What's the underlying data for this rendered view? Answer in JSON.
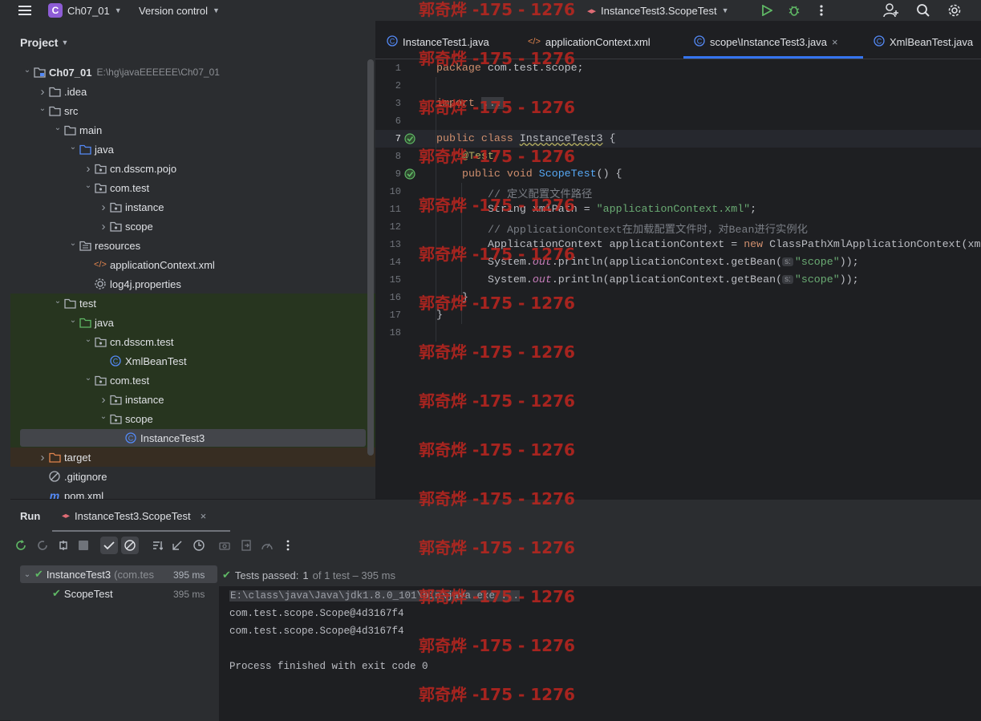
{
  "topbar": {
    "project_badge": "C",
    "project_name": "Ch07_01",
    "vcs_label": "Version control",
    "run_config": "InstanceTest3.ScopeTest"
  },
  "project_panel": {
    "title": "Project",
    "tree": [
      {
        "label": "Ch07_01",
        "path": "E:\\hg\\javaEEEEEE\\Ch07_01",
        "icon": "module-folder-icon"
      },
      {
        "label": ".idea",
        "icon": "folder-icon"
      },
      {
        "label": "src",
        "icon": "folder-icon"
      },
      {
        "label": "main",
        "icon": "folder-icon"
      },
      {
        "label": "java",
        "icon": "source-folder-icon"
      },
      {
        "label": "cn.dsscm.pojo",
        "icon": "package-icon"
      },
      {
        "label": "com.test",
        "icon": "package-icon"
      },
      {
        "label": "instance",
        "icon": "package-icon"
      },
      {
        "label": "scope",
        "icon": "package-icon"
      },
      {
        "label": "resources",
        "icon": "resources-folder-icon"
      },
      {
        "label": "applicationContext.xml",
        "icon": "xml-file-icon"
      },
      {
        "label": "log4j.properties",
        "icon": "properties-file-icon"
      },
      {
        "label": "test",
        "icon": "folder-icon"
      },
      {
        "label": "java",
        "icon": "test-source-folder-icon"
      },
      {
        "label": "cn.dsscm.test",
        "icon": "package-icon"
      },
      {
        "label": "XmlBeanTest",
        "icon": "class-icon"
      },
      {
        "label": "com.test",
        "icon": "package-icon"
      },
      {
        "label": "instance",
        "icon": "package-icon"
      },
      {
        "label": "scope",
        "icon": "package-icon"
      },
      {
        "label": "InstanceTest3",
        "icon": "class-icon"
      },
      {
        "label": "target",
        "icon": "excluded-folder-icon"
      },
      {
        "label": ".gitignore",
        "icon": "ignore-file-icon"
      },
      {
        "label": "pom.xml",
        "icon": "maven-file-icon"
      }
    ]
  },
  "editor_tabs": [
    {
      "label": "InstanceTest1.java"
    },
    {
      "label": "applicationContext.xml"
    },
    {
      "label": "scope\\InstanceTest3.java",
      "close": "×"
    },
    {
      "label": "XmlBeanTest.java"
    }
  ],
  "code": {
    "line_numbers": [
      "1",
      "2",
      "3",
      "6",
      "7",
      "8",
      "9",
      "10",
      "11",
      "12",
      "13",
      "14",
      "15",
      "16",
      "17",
      "18"
    ],
    "l1_kw": "package",
    "l1_rest": " com.test.scope;",
    "l3_kw": "import",
    "l3_fold": "...",
    "l7_kw": "public class",
    "l7_cls": "InstanceTest3",
    "l7_rest": " {",
    "l8_ann": "@Test",
    "l9_kw": "public void",
    "l9_fn": "ScopeTest",
    "l9_rest": "() {",
    "l10_cm": "// 定义配置文件路径",
    "l11_a": "String xmlPath = ",
    "l11_str": "\"applicationContext.xml\"",
    "l11_b": ";",
    "l12_cm": "// ApplicationContext在加载配置文件时，对Bean进行实例化",
    "l13_a": "ApplicationContext applicationContext = ",
    "l13_kw": "new",
    "l13_b": " ClassPathXmlApplicationContext(xm",
    "l14_a": "System.",
    "l14_it": "out",
    "l14_b": ".println(applicationContext.getBean(",
    "l14_hint": "s:",
    "l14_str": "\"scope\"",
    "l14_c": "));",
    "l15_a": "System.",
    "l15_it": "out",
    "l15_b": ".println(applicationContext.getBean(",
    "l15_hint": "s:",
    "l15_str": "\"scope\"",
    "l15_c": "));",
    "l16": "}",
    "l17": "}"
  },
  "run_panel": {
    "title": "Run",
    "tab_label": "InstanceTest3.ScopeTest",
    "tab_close": "×",
    "tests": [
      {
        "name": "InstanceTest3",
        "detail": "(com.tes",
        "time": "395 ms"
      },
      {
        "name": "ScopeTest",
        "time": "395 ms"
      }
    ],
    "status_prefix": "Tests passed:",
    "status_count": "1",
    "status_rest": "of 1 test – 395 ms",
    "console": [
      "E:\\class\\java\\Java\\jdk1.8.0_101\\bin\\java.exe ...",
      "com.test.scope.Scope@4d3167f4",
      "com.test.scope.Scope@4d3167f4",
      "",
      "Process finished with exit code 0"
    ]
  },
  "watermark": "郭奇烨 -175 - 1276",
  "colors": {
    "accent": "#3574f0",
    "pass_green": "#5fb865",
    "watermark_red": "#c0261f"
  }
}
